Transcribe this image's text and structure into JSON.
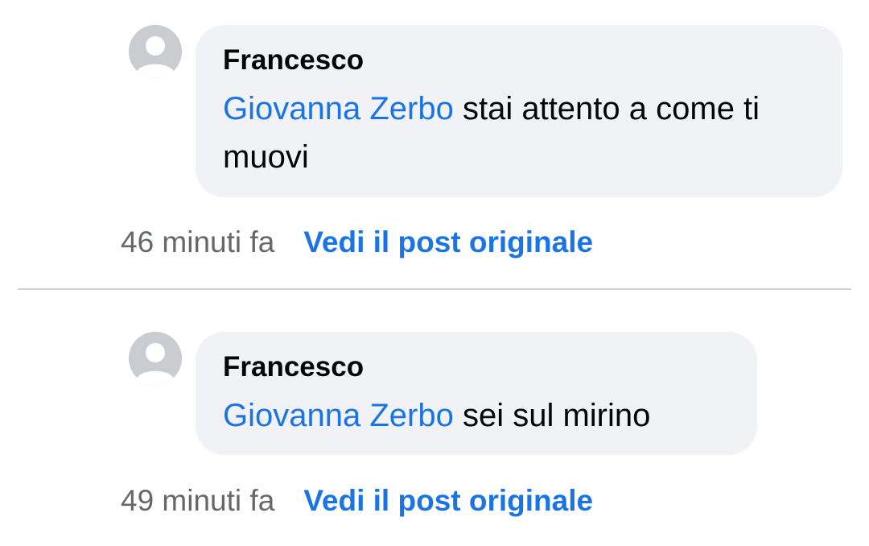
{
  "comments": [
    {
      "author": "Francesco",
      "mention": "Giovanna Zerbo",
      "text": "stai attento a come ti muovi",
      "timestamp": "46 minuti fa",
      "link_label": "Vedi il post originale"
    },
    {
      "author": "Francesco",
      "mention": "Giovanna Zerbo",
      "text": "sei sul mirino",
      "timestamp": "49 minuti fa",
      "link_label": "Vedi il post originale"
    }
  ],
  "colors": {
    "link": "#1b74e4",
    "bubble": "#f0f2f5",
    "avatar": "#c9ccd1",
    "meta_text": "#65676b"
  },
  "icons": {
    "avatar": "default-user-avatar-icon"
  }
}
